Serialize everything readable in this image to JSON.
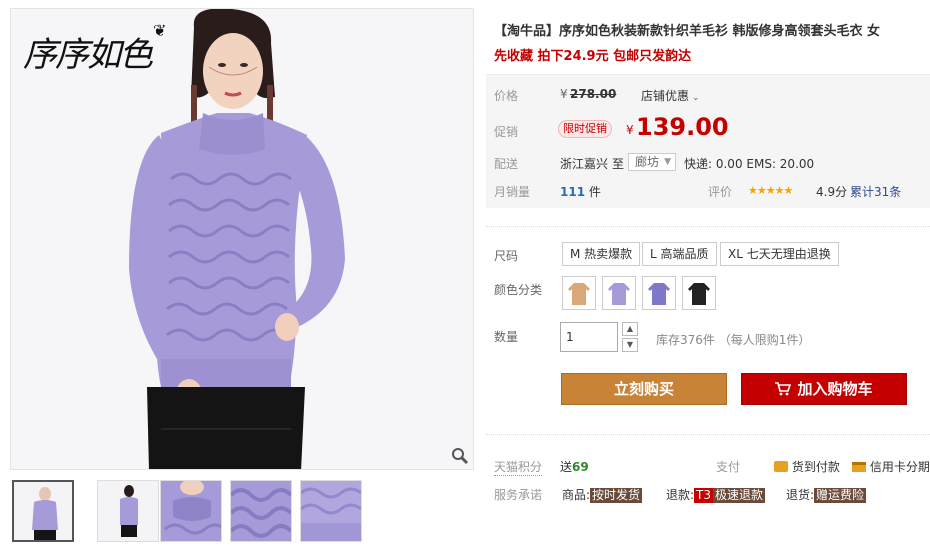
{
  "gallery": {
    "logo_text": "序序如色",
    "thumbnail_count": 5
  },
  "product": {
    "title": "【淘牛品】序序如色秋装新款针织羊毛衫 韩版修身高领套头毛衣 女",
    "subtitle": "先收藏 拍下24.9元 包邮只发韵达"
  },
  "price": {
    "label": "价格",
    "currency": "¥",
    "original": "278.00",
    "store_discount": "店铺优惠",
    "promo_label": "促销",
    "promo_badge": "限时促销",
    "promo_price": "139.00"
  },
  "shipping": {
    "label": "配送",
    "from": "浙江嘉兴",
    "to_word": "至",
    "to_value": "廊坊",
    "fees": "快递: 0.00 EMS: 20.00"
  },
  "sales": {
    "label": "月销量",
    "count": "111",
    "unit": "件",
    "review_label": "评价",
    "stars": "★★★★★",
    "score": "4.9分",
    "review_count": "累计31条"
  },
  "options": {
    "size_label": "尺码",
    "sizes": [
      "M 热卖爆款",
      "L 高端品质",
      "XL 七天无理由退换"
    ],
    "color_label": "颜色分类",
    "colors": [
      "#d9a878",
      "#a69ad8",
      "#7f78c8",
      "#222222"
    ],
    "qty_label": "数量",
    "qty_value": "1",
    "stock": "库存376件",
    "limit": "（每人限购1件）"
  },
  "actions": {
    "buy": "立刻购买",
    "add_cart": "加入购物车"
  },
  "services": {
    "points_label": "天猫积分",
    "points_prefix": "送",
    "points_value": "69",
    "pay_label": "支付",
    "cod": "货到付款",
    "credit": "信用卡分期",
    "promise_label": "服务承诺",
    "goods_prefix": "商品:",
    "goods_tag": "按时发货",
    "refund_prefix": "退款:",
    "refund_t3": "T3",
    "refund_tag": "极速退款",
    "return_prefix": "退货:",
    "return_tag": "赠运费险"
  },
  "colors": {
    "brand_red": "#c40000",
    "buy_orange": "#c88337",
    "sweater_lavender": "#a69ad8"
  }
}
